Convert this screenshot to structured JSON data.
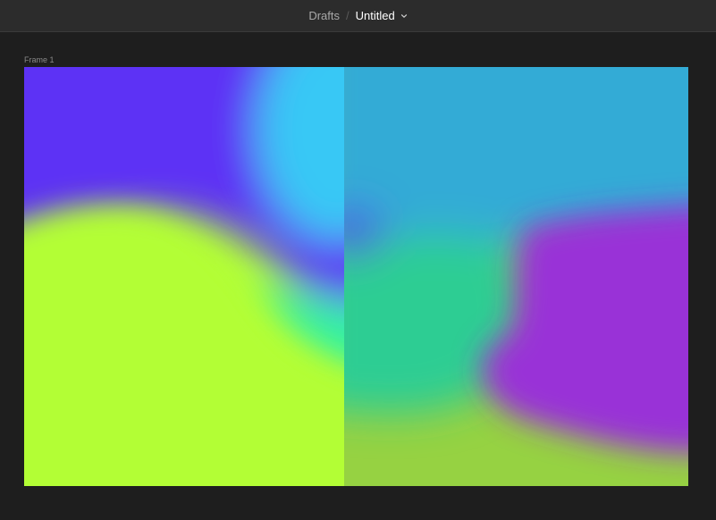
{
  "header": {
    "breadcrumb_parent": "Drafts",
    "separator": "/",
    "file_name": "Untitled"
  },
  "canvas": {
    "frame_label": "Frame 1"
  },
  "gradient_colors": {
    "purple": "#5d33f5",
    "cyan_left": "#39c8f5",
    "sky_right": "#35b5df",
    "lime_left": "#b3fe36",
    "lime_right": "#a3e03a",
    "mint": "#33f2a3",
    "teal": "#2ddb95",
    "magenta": "#a62ee0"
  },
  "icons": {
    "file_menu": "chevron-down-icon"
  }
}
